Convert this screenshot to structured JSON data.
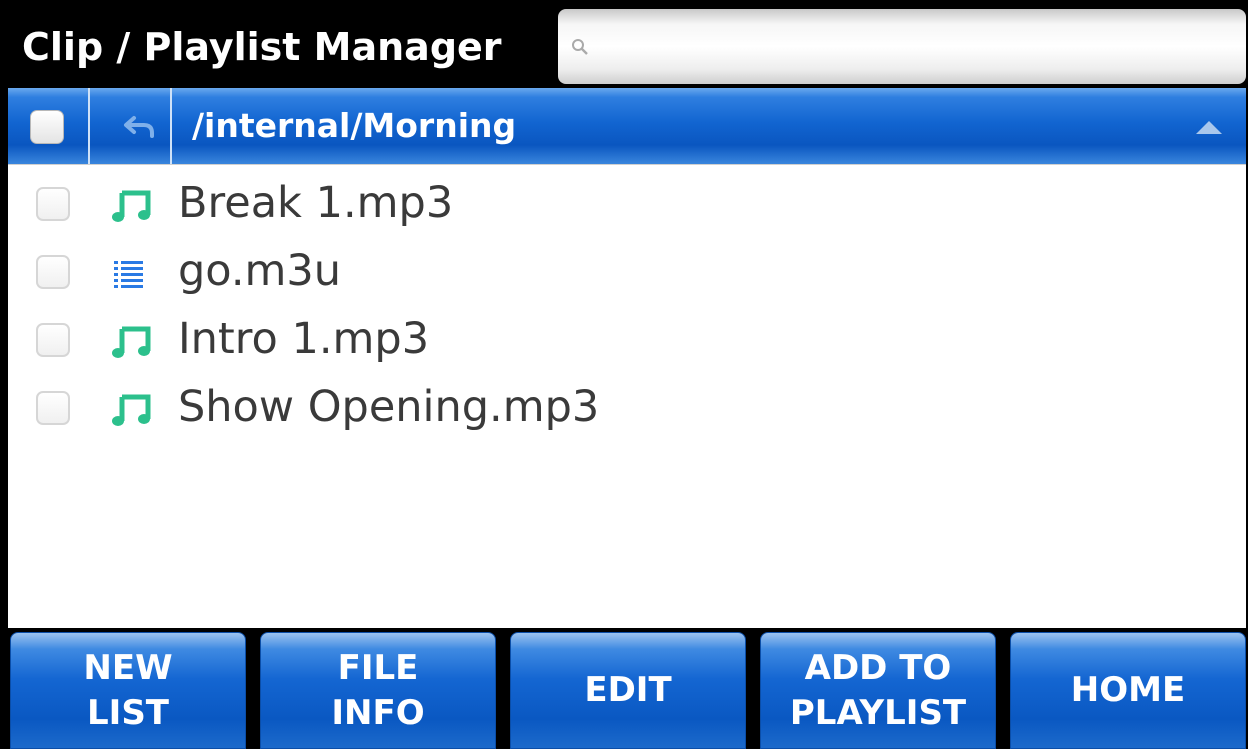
{
  "header": {
    "title": "Clip / Playlist Manager",
    "search_value": "",
    "search_icon": "search-icon"
  },
  "pathbar": {
    "path": "/internal/Morning",
    "select_all_checked": false,
    "back_icon": "back-arrow-icon",
    "sort_icon": "triangle-up-icon"
  },
  "files": [
    {
      "name": "Break 1.mp3",
      "type": "audio",
      "icon": "music-note-icon",
      "checked": false
    },
    {
      "name": "go.m3u",
      "type": "playlist",
      "icon": "list-icon",
      "checked": false
    },
    {
      "name": "Intro 1.mp3",
      "type": "audio",
      "icon": "music-note-icon",
      "checked": false
    },
    {
      "name": "Show Opening.mp3",
      "type": "audio",
      "icon": "music-note-icon",
      "checked": false
    }
  ],
  "buttons": {
    "new_list": "NEW\nLIST",
    "file_info": "FILE\nINFO",
    "edit": "EDIT",
    "add_to_playlist": "ADD TO\nPLAYLIST",
    "home": "HOME"
  },
  "colors": {
    "accent_blue": "#0a56c0",
    "audio_icon": "#2cc08c",
    "playlist_icon": "#2a7ae4"
  }
}
